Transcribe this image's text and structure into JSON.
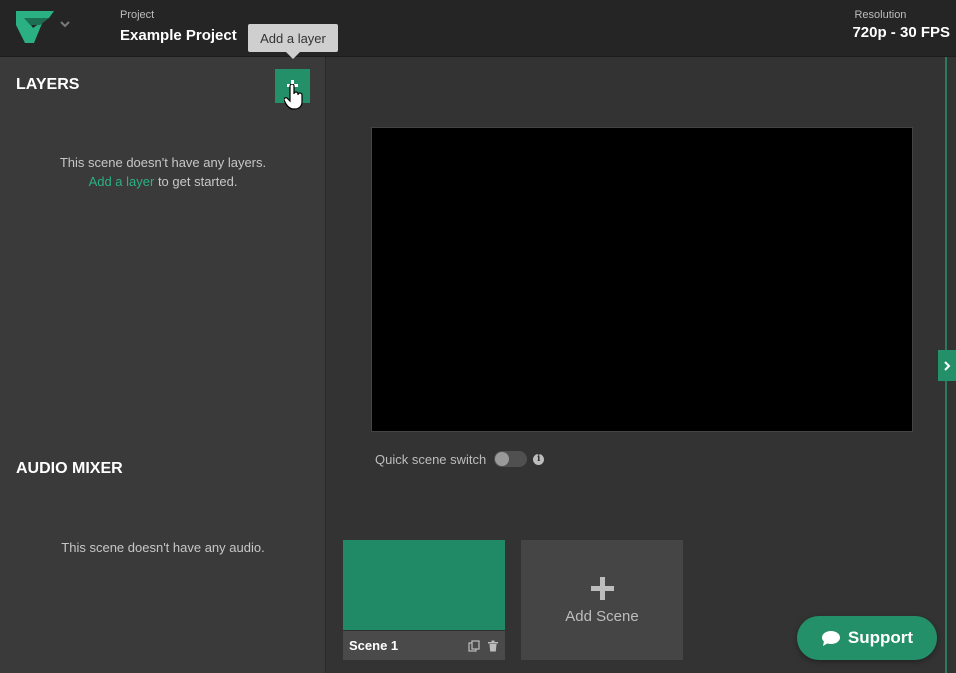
{
  "header": {
    "project_caption": "Project",
    "project_name": "Example Project",
    "resolution_caption": "Resolution",
    "resolution_value": "720p - 30 FPS",
    "logo_icon": "streaming-logo-icon",
    "menu_icon": "chevron-down-icon"
  },
  "tooltip": {
    "text": "Add a layer"
  },
  "layers": {
    "title": "LAYERS",
    "add_icon": "plus-icon",
    "empty_line1": "This scene doesn't have any layers.",
    "empty_link": "Add a layer",
    "empty_line2_suffix": " to get started."
  },
  "audio": {
    "title": "AUDIO MIXER",
    "empty_text": "This scene doesn't have any audio."
  },
  "preview": {
    "quick_switch_label": "Quick scene switch",
    "quick_switch_on": false,
    "info_icon": "info-icon"
  },
  "scenes": {
    "items": [
      {
        "name": "Scene 1",
        "thumbnail_color": "#208a67"
      }
    ],
    "add_label": "Add Scene"
  },
  "support": {
    "label": "Support",
    "icon": "chat-bubble-icon"
  },
  "colors": {
    "accent": "#23906a",
    "link": "#2bb083",
    "background": "#333333"
  }
}
